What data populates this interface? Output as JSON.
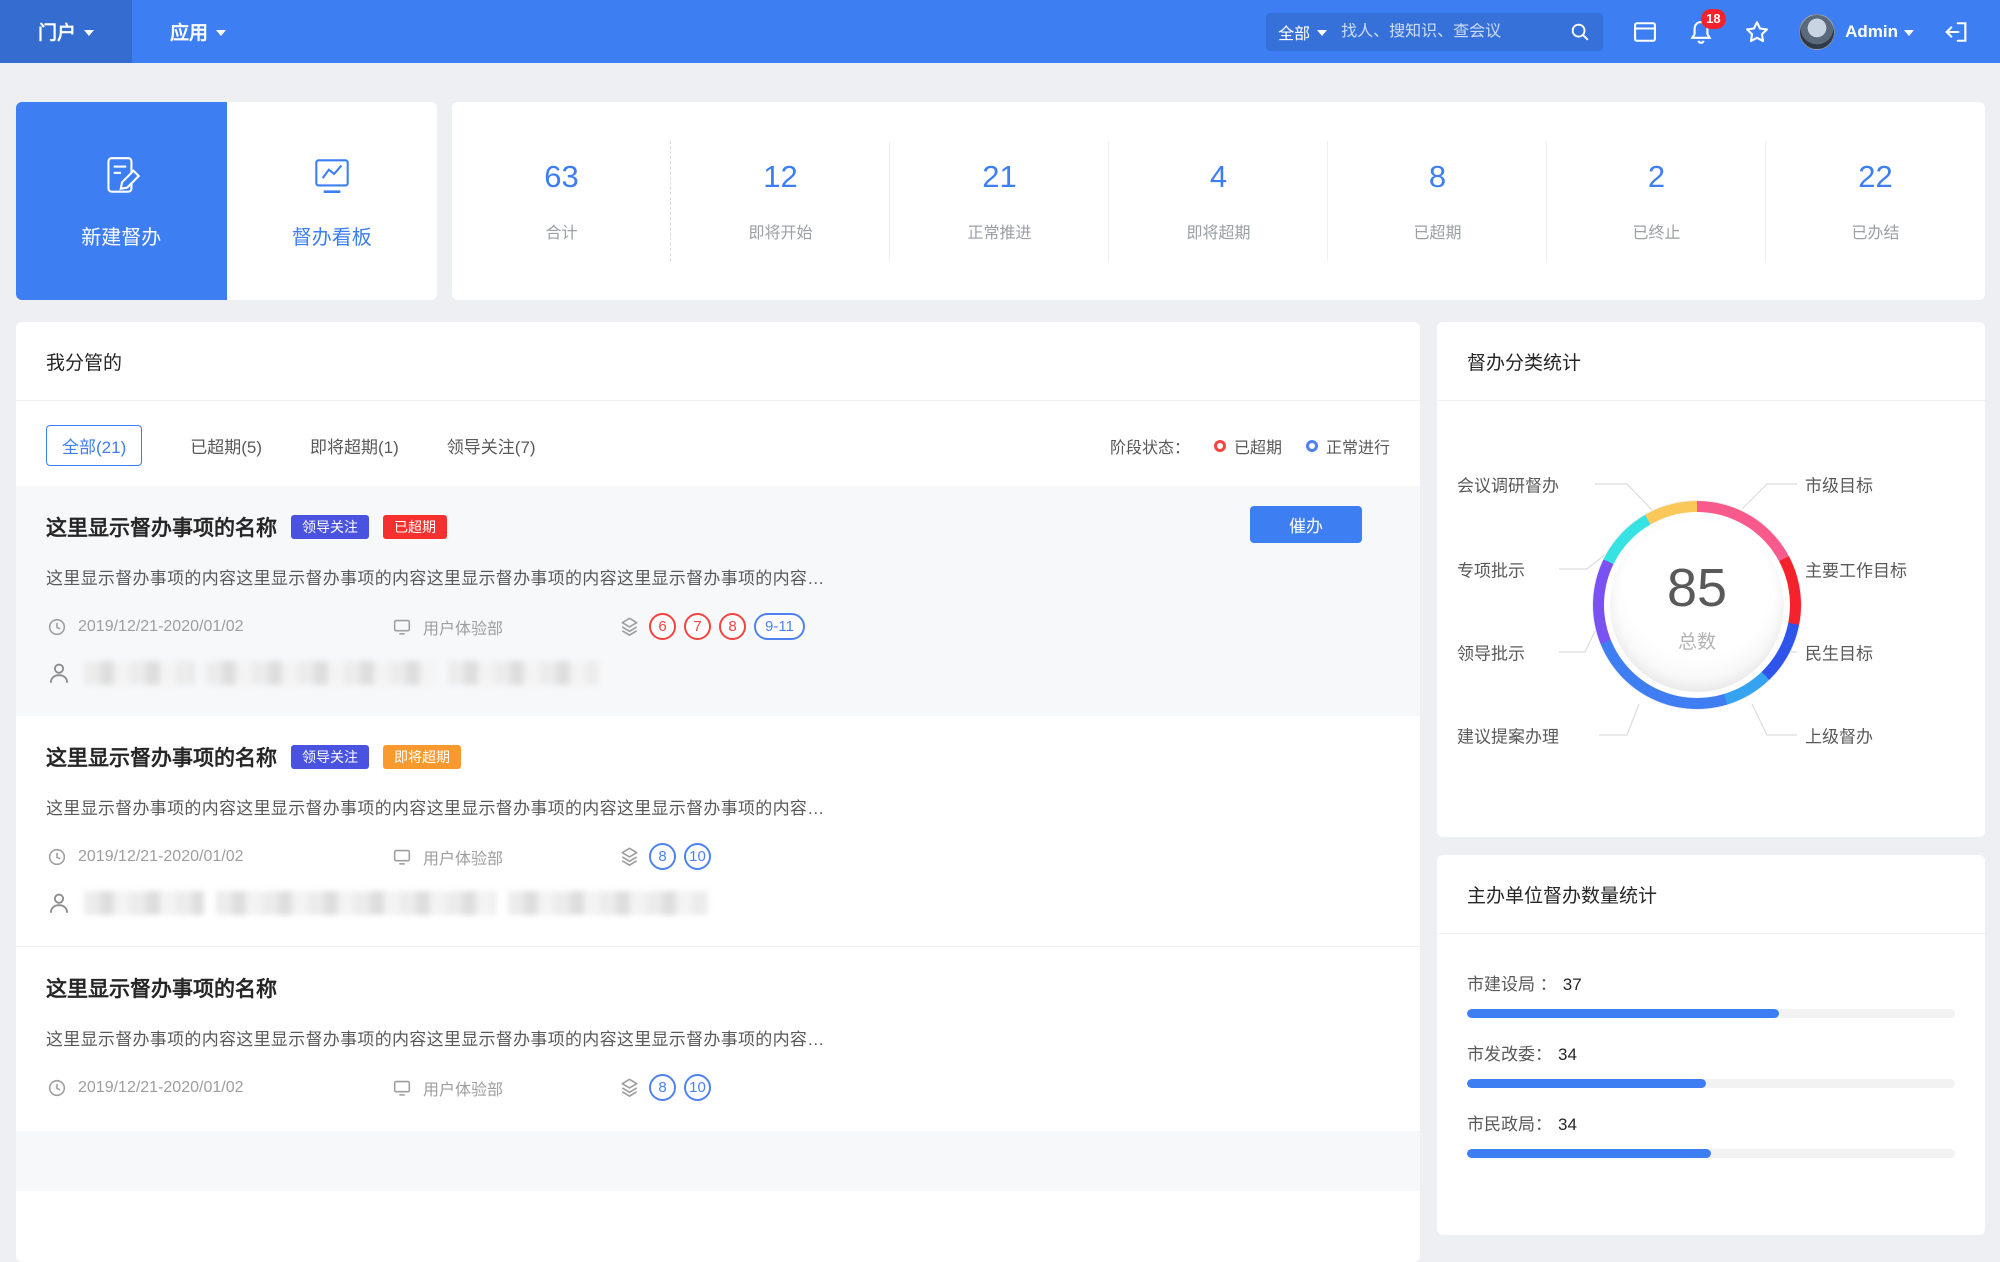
{
  "colors": {
    "primary": "#3D7EF2",
    "red": "#F5302E",
    "orange": "#FA9A2E",
    "indigo": "#4A52E0"
  },
  "topbar": {
    "nav": [
      {
        "label": "门户"
      },
      {
        "label": "应用"
      }
    ],
    "search": {
      "filter": "全部",
      "placeholder": "找人、搜知识、查会议"
    },
    "notification_count": "18",
    "user_name": "Admin"
  },
  "actions": {
    "new_task": "新建督办",
    "board": "督办看板"
  },
  "stats": [
    {
      "value": "63",
      "label": "合计"
    },
    {
      "value": "12",
      "label": "即将开始"
    },
    {
      "value": "21",
      "label": "正常推进"
    },
    {
      "value": "4",
      "label": "即将超期"
    },
    {
      "value": "8",
      "label": "已超期"
    },
    {
      "value": "2",
      "label": "已终止"
    },
    {
      "value": "22",
      "label": "已办结"
    }
  ],
  "list_panel": {
    "title": "我分管的",
    "tabs": [
      {
        "label": "全部(21)"
      },
      {
        "label": "已超期(5)"
      },
      {
        "label": "即将超期(1)"
      },
      {
        "label": "领导关注(7)"
      }
    ],
    "legend": {
      "label": "阶段状态：",
      "items": [
        {
          "label": "已超期",
          "color": "#F5433F"
        },
        {
          "label": "正常进行",
          "color": "#4E82F0"
        }
      ]
    },
    "urge_button": "催办",
    "items": [
      {
        "title": "这里显示督办事项的名称",
        "badges": [
          {
            "label": "领导关注",
            "color": "#4A52E0"
          },
          {
            "label": "已超期",
            "color": "#F5302E"
          }
        ],
        "content": "这里显示督办事项的内容这里显示督办事项的内容这里显示督办事项的内容这里显示督办事项的内容…",
        "date": "2019/12/21-2020/01/02",
        "department": "用户体验部",
        "stages": [
          {
            "label": "6",
            "color": "#F5433F"
          },
          {
            "label": "7",
            "color": "#F5433F"
          },
          {
            "label": "8",
            "color": "#F5433F"
          },
          {
            "label": "9-11",
            "color": "#4E82F0"
          }
        ]
      },
      {
        "title": "这里显示督办事项的名称",
        "badges": [
          {
            "label": "领导关注",
            "color": "#4A52E0"
          },
          {
            "label": "即将超期",
            "color": "#FA9A2E"
          }
        ],
        "content": "这里显示督办事项的内容这里显示督办事项的内容这里显示督办事项的内容这里显示督办事项的内容…",
        "date": "2019/12/21-2020/01/02",
        "department": "用户体验部",
        "stages": [
          {
            "label": "8",
            "color": "#4E82F0"
          },
          {
            "label": "10",
            "color": "#4E82F0"
          }
        ]
      },
      {
        "title": "这里显示督办事项的名称",
        "badges": [],
        "content": "这里显示督办事项的内容这里显示督办事项的内容这里显示督办事项的内容这里显示督办事项的内容…",
        "date": "2019/12/21-2020/01/02",
        "department": "用户体验部",
        "stages": [
          {
            "label": "8",
            "color": "#4E82F0"
          },
          {
            "label": "10",
            "color": "#4E82F0"
          }
        ]
      }
    ]
  },
  "category_panel": {
    "title": "督办分类统计",
    "total": "85",
    "total_label": "总数",
    "labels_left": [
      "会议调研督办",
      "专项批示",
      "领导批示",
      "建议提案办理"
    ],
    "labels_right": [
      "市级目标",
      "主要工作目标",
      "民生目标",
      "上级督办"
    ]
  },
  "org_panel": {
    "title": "主办单位督办数量统计",
    "rows": [
      {
        "label": "市建设局 ：",
        "value": "37",
        "percent": "64%"
      },
      {
        "label": "市发改委：",
        "value": "34",
        "percent": "49%"
      },
      {
        "label": "市民政局：",
        "value": "34",
        "percent": "50%"
      }
    ]
  },
  "chart_data": [
    {
      "type": "pie",
      "subtype": "donut",
      "title": "督办分类统计",
      "center_value": 85,
      "center_label": "总数",
      "legend_position": "sides",
      "segments": [
        {
          "label": "市级目标",
          "color": "#F85B8B",
          "from_deg": 0,
          "to_deg": 62
        },
        {
          "label": "主要工作目标",
          "color": "#F5222D",
          "from_deg": 62,
          "to_deg": 101
        },
        {
          "label": "民生目标",
          "color": "#2F54EB",
          "from_deg": 101,
          "to_deg": 136
        },
        {
          "label": "上级督办",
          "color": "#36A3F0",
          "from_deg": 136,
          "to_deg": 163
        },
        {
          "label": "建议提案办理",
          "color": "#3E7EF2",
          "from_deg": 163,
          "to_deg": 248
        },
        {
          "label": "领导批示",
          "color": "#7A52F4",
          "from_deg": 248,
          "to_deg": 296
        },
        {
          "label": "专项批示",
          "color": "#36E2E2",
          "from_deg": 296,
          "to_deg": 330
        },
        {
          "label": "会议调研督办",
          "color": "#FAC858",
          "from_deg": 330,
          "to_deg": 360
        }
      ]
    },
    {
      "type": "bar",
      "title": "主办单位督办数量统计",
      "categories": [
        "市建设局",
        "市发改委",
        "市民政局"
      ],
      "values": [
        37,
        34,
        34
      ],
      "bar_color": "#3D7EF2"
    }
  ]
}
